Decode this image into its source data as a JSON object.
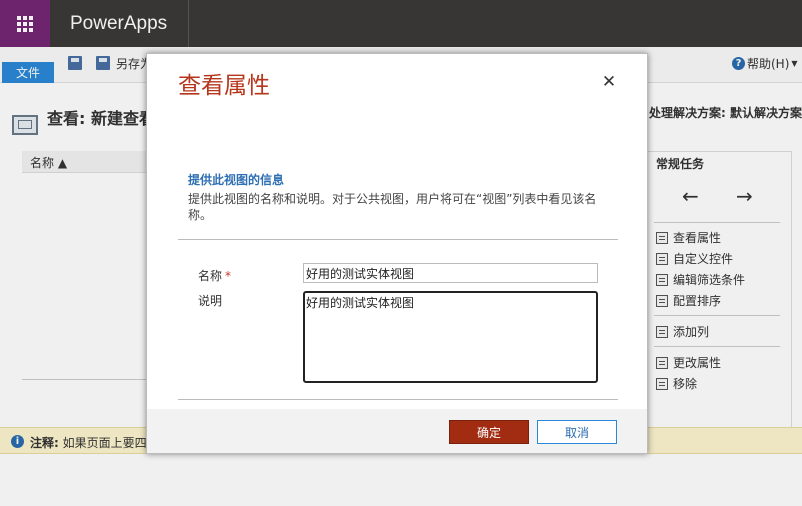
{
  "topbar": {
    "app_name": "PowerApps",
    "waffle_icon": "waffle-icon"
  },
  "ribbon": {
    "file_tab": "文件",
    "save_as_label": "另存为",
    "help_label": "帮助(H)",
    "help_icon": "question-circle-icon"
  },
  "view": {
    "title": "查看: 新建查看",
    "solution_label": "处理解决方案: 默认解决方案",
    "grid_column": "名称 ▲"
  },
  "tasks": {
    "title": "常规任务",
    "left_arrow": "←",
    "right_arrow": "→",
    "items": [
      "查看属性",
      "自定义控件",
      "编辑筛选条件",
      "配置排序",
      "添加列",
      "更改属性",
      "移除"
    ]
  },
  "notice": {
    "label": "注释:",
    "text": " 如果页面上要四"
  },
  "dialog": {
    "title": "查看属性",
    "close_glyph": "✕",
    "section_heading": "提供此视图的信息",
    "section_desc": "提供此视图的名称和说明。对于公共视图，用户将可在“视图”列表中看见该名称。",
    "name_label": "名称",
    "required_mark": "*",
    "name_value": "好用的测试实体视图",
    "desc_label": "说明",
    "desc_value": "好用的测试实体视图",
    "ok_label": "确定",
    "cancel_label": "取消"
  },
  "colors": {
    "accent_title": "#b5361a",
    "ok_button": "#a22c12",
    "heading_blue": "#2f6fb3",
    "waffle": "#742774",
    "topbar": "#3b3a39"
  }
}
